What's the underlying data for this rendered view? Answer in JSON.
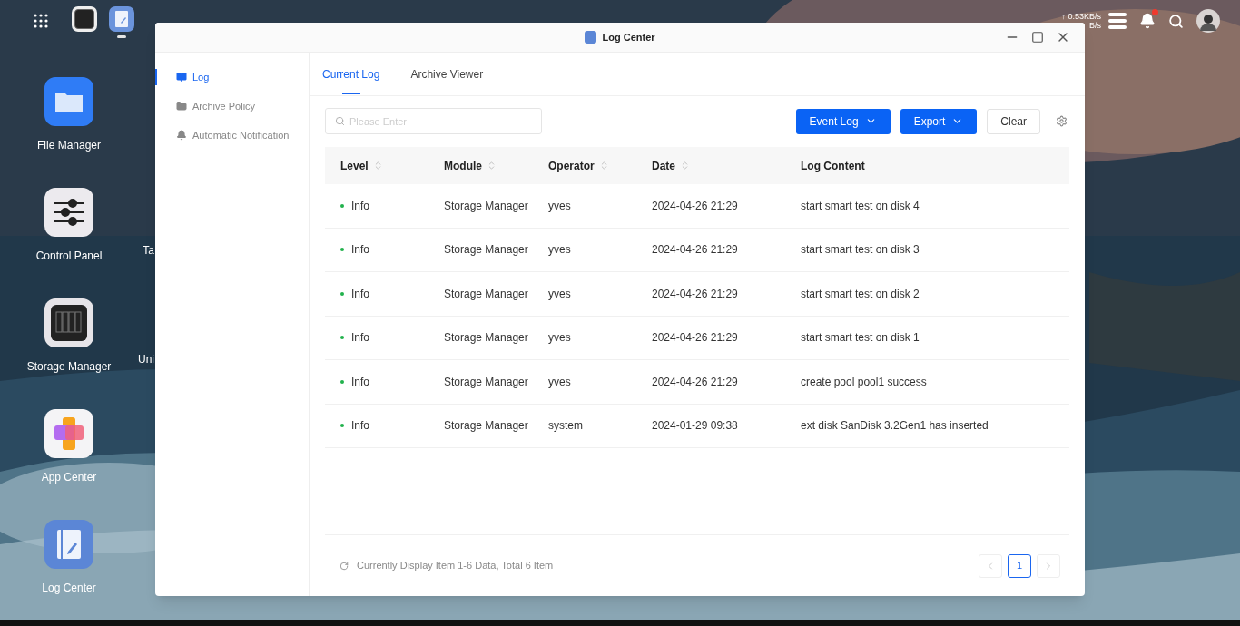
{
  "taskbar": {
    "apps": [
      {
        "kind": "storage",
        "selected": false
      },
      {
        "kind": "log",
        "selected": true
      }
    ],
    "upload_speed": "↑ 0.53KB/s",
    "download_speed": "B/s",
    "notification_badge": true
  },
  "desktop_icons": [
    {
      "label": "File Manager",
      "kind": "files"
    },
    {
      "label": "Control Panel",
      "kind": "control"
    },
    {
      "label": "Storage Manager",
      "kind": "storage"
    },
    {
      "label": "App Center",
      "kind": "apps"
    },
    {
      "label": "Log Center",
      "kind": "log"
    }
  ],
  "desktop_icons_column_2": [
    {
      "label": "Ta"
    },
    {
      "label": "Uni"
    }
  ],
  "window": {
    "title": "Log Center",
    "sidebar": [
      {
        "label": "Log",
        "kind": "log",
        "selected": true
      },
      {
        "label": "Archive Policy",
        "kind": "folder",
        "selected": false
      },
      {
        "label": "Automatic Notification",
        "kind": "bell",
        "selected": false
      }
    ],
    "tabs": [
      {
        "label": "Current Log",
        "selected": true
      },
      {
        "label": "Archive Viewer",
        "selected": false
      }
    ],
    "search": {
      "placeholder": "Please Enter"
    },
    "buttons": [
      {
        "label": "Event Log",
        "kind": "dropdown"
      },
      {
        "label": "Export",
        "kind": "dropdown"
      },
      {
        "label": "Clear",
        "kind": "plain"
      }
    ],
    "table": {
      "columns": [
        {
          "label": "Level",
          "sortable": true
        },
        {
          "label": "Module",
          "sortable": true
        },
        {
          "label": "Operator",
          "sortable": true
        },
        {
          "label": "Date",
          "sortable": true
        },
        {
          "label": "Log Content",
          "sortable": false
        }
      ],
      "rows": [
        {
          "level": "Info",
          "color": "#22b14c",
          "module": "Storage Manager",
          "operator": "yves",
          "date": "2024-04-26 21:29",
          "content": "start smart test on disk 4"
        },
        {
          "level": "Info",
          "color": "#22b14c",
          "module": "Storage Manager",
          "operator": "yves",
          "date": "2024-04-26 21:29",
          "content": "start smart test on disk 3"
        },
        {
          "level": "Info",
          "color": "#22b14c",
          "module": "Storage Manager",
          "operator": "yves",
          "date": "2024-04-26 21:29",
          "content": "start smart test on disk 2"
        },
        {
          "level": "Info",
          "color": "#22b14c",
          "module": "Storage Manager",
          "operator": "yves",
          "date": "2024-04-26 21:29",
          "content": "start smart test on disk 1"
        },
        {
          "level": "Info",
          "color": "#22b14c",
          "module": "Storage Manager",
          "operator": "yves",
          "date": "2024-04-26 21:29",
          "content": "create pool pool1 success"
        },
        {
          "level": "Info",
          "color": "#22b14c",
          "module": "Storage Manager",
          "operator": "system",
          "date": "2024-01-29 09:38",
          "content": "ext disk SanDisk 3.2Gen1 has inserted"
        }
      ]
    },
    "footer": "Currently Display Item 1-6 Data, Total 6 Item",
    "pagination": {
      "pages": [
        {
          "label": "1",
          "selected": true
        }
      ]
    }
  }
}
